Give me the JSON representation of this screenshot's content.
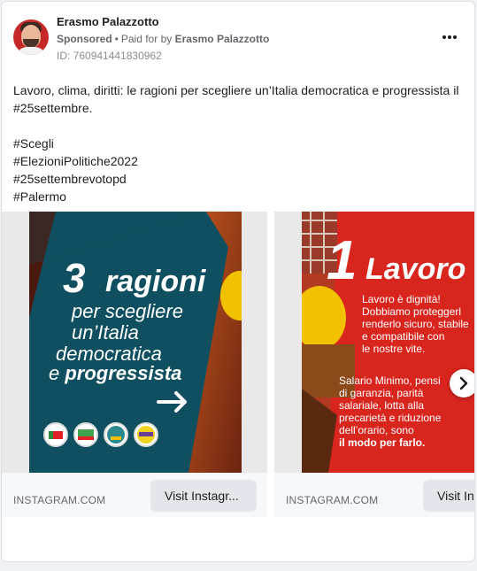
{
  "post": {
    "author": "Erasmo Palazzotto",
    "sponsored": "Sponsored",
    "separator": "•",
    "paid_for_prefix": "Paid for by",
    "paid_for_by": "Erasmo Palazzotto",
    "ad_id": "ID: 760941441830962",
    "more_icon": "more-horizontal-icon",
    "text_lines": [
      "Lavoro, clima, diritti: le ragioni per scegliere un’Italia democratica e progressista il #25settembre.",
      "#Scegli",
      "#ElezioniPolitiche2022",
      "#25settembrevotopd",
      "#Palermo"
    ]
  },
  "carousel": {
    "cards": [
      {
        "poster": {
          "number": "3",
          "word": "ragioni",
          "line1": "per scegliere",
          "line2": "un’Italia",
          "line3": "democratica",
          "line4_a": "e ",
          "line4_b": "progressista",
          "arrow": "→"
        },
        "domain": "INSTAGRAM.COM",
        "cta": "Visit Instagr..."
      },
      {
        "poster": {
          "number": "1",
          "word": "Lavoro",
          "para1": [
            "Lavoro è dignità!",
            "Dobbiamo proteggerl",
            "renderlo sicuro, stabile",
            "e compatibile con",
            "le nostre vite."
          ],
          "para2": [
            "Salario Minimo, pensi",
            "di garanzia, parità",
            "salariale, lotta alla",
            "precarietà e riduzione",
            "dell’orario, sono"
          ],
          "para2_bold": "il modo per farlo."
        },
        "domain": "INSTAGRAM.COM",
        "cta": "Visit Ins"
      }
    ],
    "next_icon": "chevron-right-icon"
  },
  "colors": {
    "poster1_bg": "#0f4f5f",
    "poster2_bg": "#d8251e",
    "cta_bg": "#e4e6eb",
    "avatar_bg": "#c62828"
  }
}
